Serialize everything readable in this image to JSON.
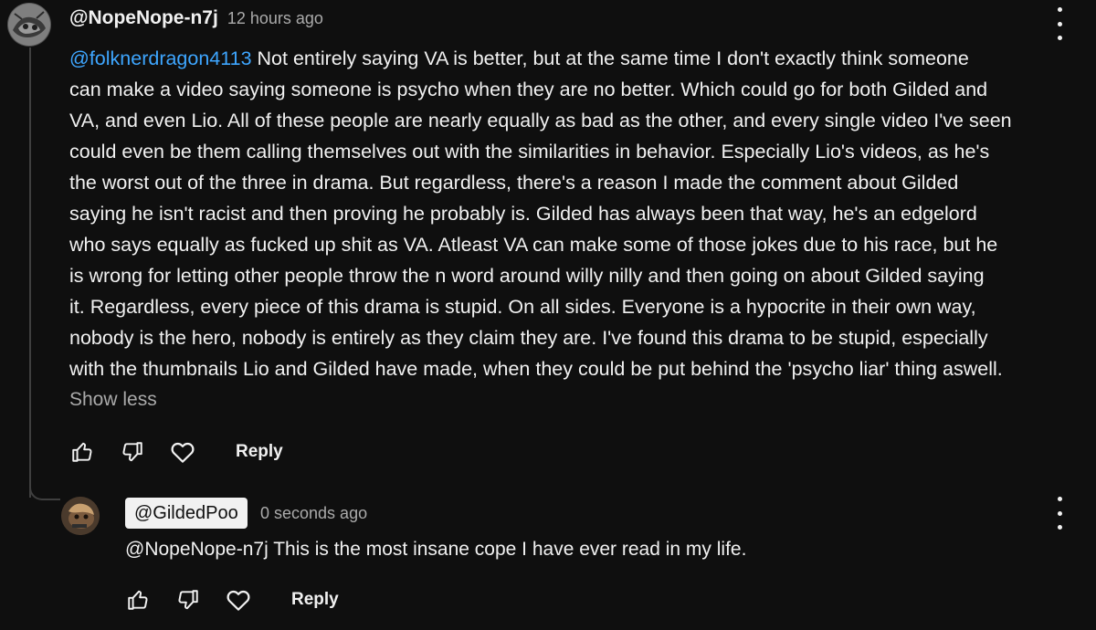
{
  "comment": {
    "author": "@NopeNope-n7j",
    "time": "12 hours ago",
    "mention": "@folknerdragon4113",
    "lines": [
      " Not entirely saying VA is better, but at the same time I don't exactly think someone",
      "can make a video saying someone is psycho when they are no better. Which could go for both Gilded and",
      "VA, and even Lio. All of these people are nearly equally as bad as the other, and every single video I've seen",
      "could even be them calling themselves out with the similarities in behavior. Especially Lio's videos, as he's",
      "the worst out of the three in drama. But regardless, there's a reason I made the comment about Gilded",
      "saying he isn't racist and then proving he probably is. Gilded has always been that way, he's an edgelord",
      "who says equally as fucked up shit as VA. Atleast VA can make some of those jokes due to his race, but he",
      "is wrong for letting other people throw the n word around willy nilly and then going on about Gilded saying",
      "it. Regardless, every piece of this drama is stupid. On all sides. Everyone is a hypocrite in their own way,",
      "nobody is the hero, nobody is entirely as they claim they are. I've found this drama to be stupid, especially",
      "with the thumbnails Lio and Gilded have made, when they could be put behind the 'psycho liar' thing aswell."
    ],
    "show_less": "Show less",
    "reply_label": "Reply"
  },
  "reply": {
    "author": "@GildedPoo",
    "time": "0 seconds ago",
    "text": "@NopeNope-n7j This is the most insane cope I have ever read in my life.",
    "reply_label": "Reply"
  },
  "icons": {
    "like": "thumbs-up-icon",
    "dislike": "thumbs-down-icon",
    "heart": "heart-icon",
    "more": "more-vert-icon"
  },
  "colors": {
    "background": "#0f0f0f",
    "text": "#f1f1f1",
    "secondary_text": "#aaaaaa",
    "mention": "#3ea6ff",
    "author_chip_bg": "#f1f1f1"
  }
}
